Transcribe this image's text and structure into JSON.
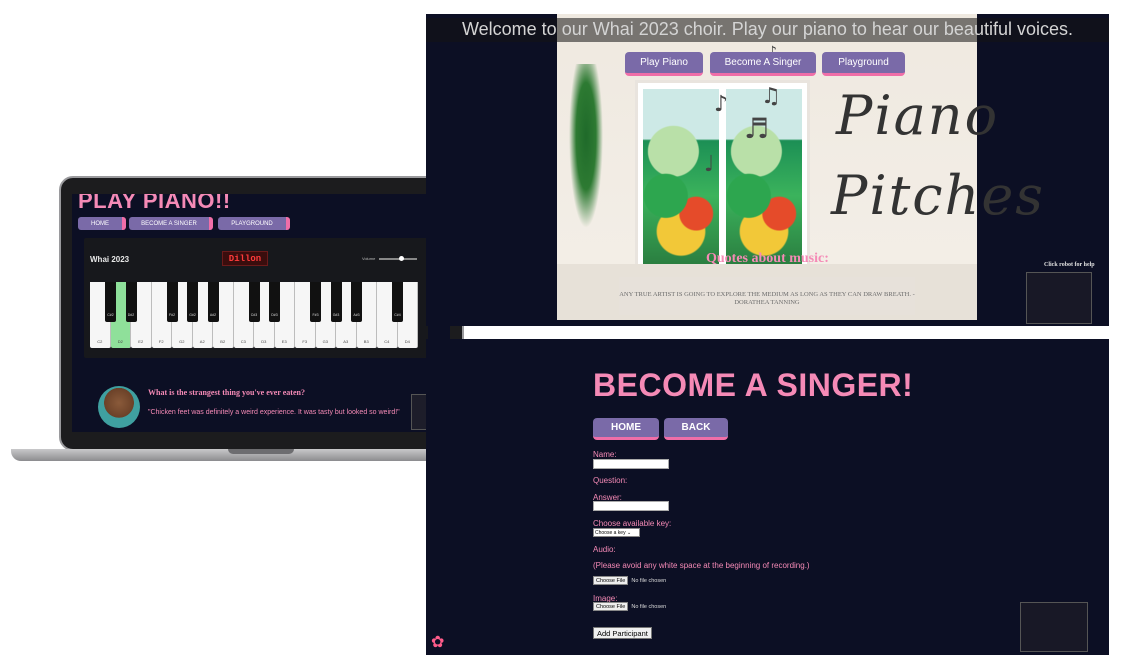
{
  "laptop": {
    "title": "PLAY PIANO!!",
    "nav": [
      "HOME",
      "BECOME A SINGER",
      "PLAYGROUND"
    ],
    "brand": "Whai 2023",
    "display": "Dillon",
    "volume_label": "Volume",
    "volume_level": 0.6,
    "white_keys": [
      "C2",
      "D2",
      "E2",
      "F2",
      "G2",
      "A2",
      "B2",
      "C3",
      "D3",
      "E3",
      "F3",
      "G3",
      "A3",
      "B3",
      "C4",
      "D4"
    ],
    "active_key": "D2",
    "black_keys": [
      "C#2",
      "D#2",
      "F#2",
      "G#2",
      "A#2",
      "C#3",
      "D#3",
      "F#3",
      "G#3",
      "A#3",
      "C#4"
    ],
    "question": "What is the strangest thing you've ever eaten?",
    "answer": "\"Chicken feet was definitely a weird experience. It was tasty but looked so weird!\""
  },
  "home_panel": {
    "banner": "Welcome to our Whai 2023 choir. Play our piano to hear our beautiful voices.",
    "buttons": [
      "Play Piano",
      "Become A Singer",
      "Playground"
    ],
    "handwriting_1": "Piano",
    "handwriting_2": "Pitches",
    "quotes_heading": "Quotes about music:",
    "quote": "ANY TRUE ARTIST IS GOING TO EXPLORE THE MEDIUM AS LONG AS THEY CAN DRAW BREATH. -DORATHEA TANNING",
    "help_text": "Click robot for help"
  },
  "singer_panel": {
    "title": "BECOME A SINGER!",
    "buttons": [
      "HOME",
      "BACK"
    ],
    "name_label": "Name:",
    "question_label": "Question:",
    "answer_label": "Answer:",
    "key_label": "Choose available key:",
    "key_select": "Choose a key",
    "audio_label": "Audio:",
    "audio_note": "(Please avoid any white space at the beginning of recording.)",
    "choose_file": "Choose File",
    "no_file": "No file chosen",
    "image_label": "Image:",
    "submit": "Add Participant"
  },
  "colors": {
    "background": "#0c0f24",
    "accent_pink": "#f58ab6",
    "button_purple": "#7a6aa8",
    "active_key": "#8fe09a"
  }
}
